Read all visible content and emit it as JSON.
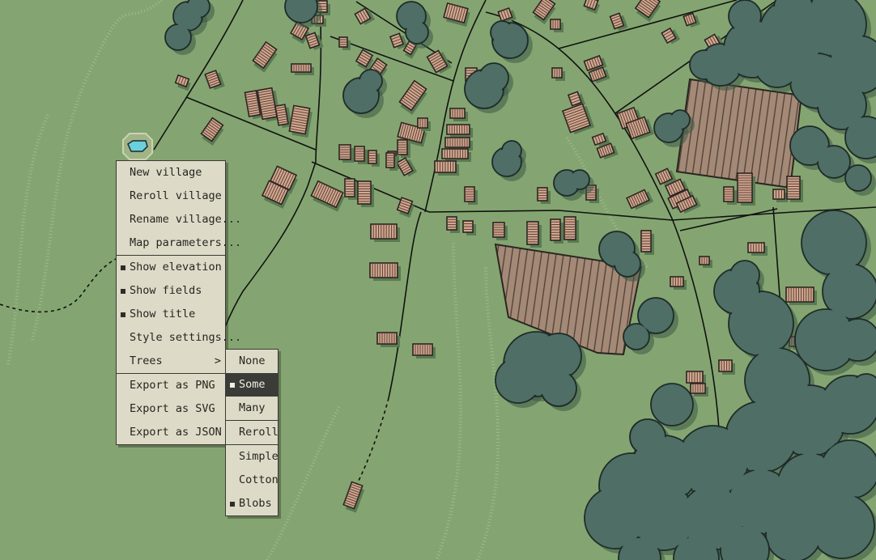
{
  "context_menu": {
    "items": [
      {
        "label": "New village"
      },
      {
        "label": "Reroll village"
      },
      {
        "label": "Rename village..."
      },
      {
        "label": "Map parameters..."
      },
      {
        "label": "Show elevation",
        "checked": true
      },
      {
        "label": "Show fields",
        "checked": true
      },
      {
        "label": "Show title",
        "checked": true
      },
      {
        "label": "Style settings..."
      },
      {
        "label": "Trees",
        "submenu_arrow": ">"
      },
      {
        "label": "Export as PNG"
      },
      {
        "label": "Export as SVG"
      },
      {
        "label": "Export as JSON"
      }
    ]
  },
  "trees_submenu": {
    "items": [
      {
        "label": "None"
      },
      {
        "label": "Some",
        "checked": true,
        "highlighted": true
      },
      {
        "label": "Many"
      },
      {
        "label": "Reroll"
      },
      {
        "label": "Simple"
      },
      {
        "label": "Cotton"
      },
      {
        "label": "Blobs",
        "checked": true
      }
    ]
  },
  "colors": {
    "grass": "#84a571",
    "tree_canopy": "#4e6e66",
    "tree_outline": "#1f2b28",
    "building_roof": "#d3a78f",
    "building_shadow": "#5a7a53",
    "field": "#a48a76",
    "road": "#111111",
    "water": "#6ad0dc",
    "menu_bg": "#dddac8",
    "menu_highlight": "#3b3b38"
  },
  "icons": {
    "village_marker": "well-icon",
    "checked": "square-check-icon"
  }
}
